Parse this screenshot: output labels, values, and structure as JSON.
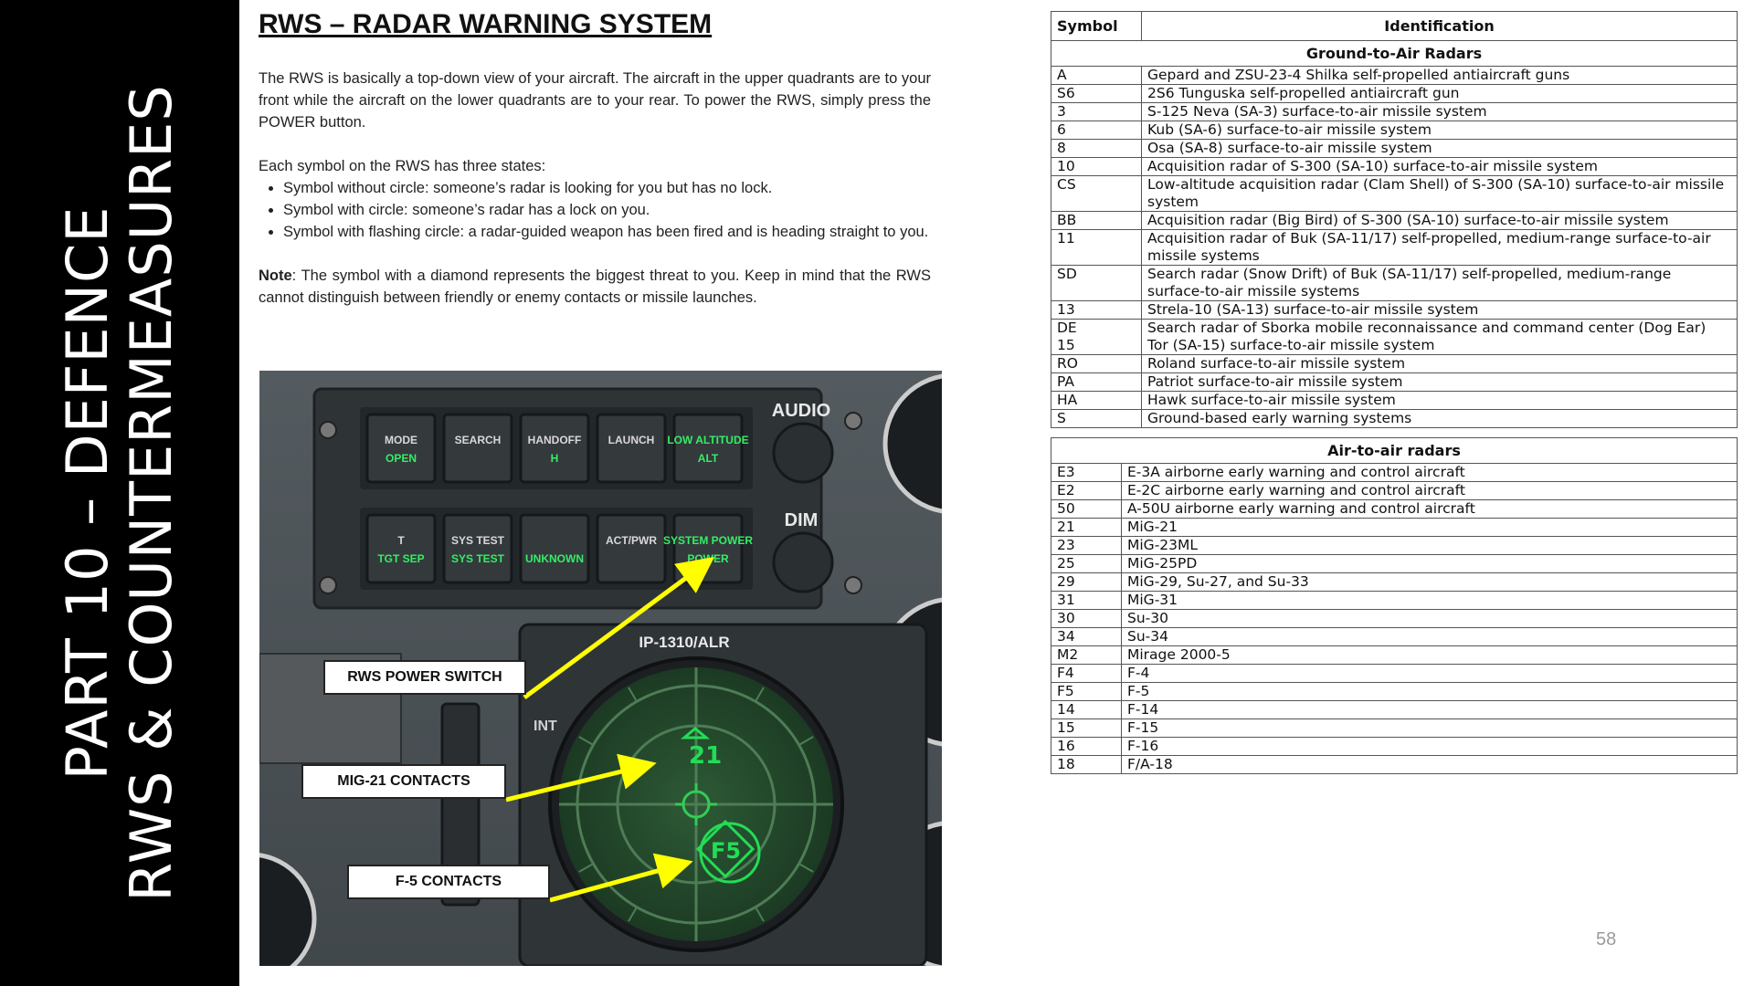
{
  "sidebar": {
    "line1": "PART 10 – DEFENCE",
    "line2": "RWS & COUNTERMEASURES"
  },
  "title": "RWS – RADAR WARNING SYSTEM",
  "intro": "The RWS is basically a top-down view of your aircraft. The aircraft in the upper quadrants are to your front while the aircraft on the lower quadrants are to your rear. To power the RWS, simply press the POWER button.",
  "states_intro": "Each symbol on the RWS has three states:",
  "states": [
    "Symbol without circle: someone’s radar is looking for you but has no lock.",
    "Symbol with circle: someone’s radar has a lock on you.",
    "Symbol with flashing circle: a radar-guided weapon has been fired and is heading straight to you."
  ],
  "note_label": "Note",
  "note_text": ": The symbol with a diamond represents the biggest threat to you. Keep in mind that the RWS cannot distinguish between friendly or enemy contacts or missile launches.",
  "figure": {
    "panel_buttons_row1": [
      {
        "top": "MODE",
        "bottom": "OPEN"
      },
      {
        "top": "SEARCH",
        "bottom": ""
      },
      {
        "top": "HANDOFF",
        "bottom": "H"
      },
      {
        "top": "LAUNCH",
        "bottom": ""
      },
      {
        "top": "LOW ALTITUDE",
        "bottom": "ALT"
      }
    ],
    "panel_buttons_row2": [
      {
        "top": "T",
        "bottom": "TGT SEP"
      },
      {
        "top": "SYS TEST",
        "bottom": "SYS TEST"
      },
      {
        "top": "",
        "bottom": "UNKNOWN"
      },
      {
        "top": "ACT/PWR",
        "bottom": ""
      },
      {
        "top": "SYSTEM POWER",
        "bottom": "POWER"
      }
    ],
    "audio_label": "AUDIO",
    "dim_label": "DIM",
    "scope_label": "IP-1310/ALR",
    "int_label": "INT",
    "contact_mig21": "21",
    "contact_f5": "F5",
    "callouts": {
      "power": "RWS POWER SWITCH",
      "mig21": "MIG-21 CONTACTS",
      "f5": "F-5 CONTACTS"
    },
    "accent": "#ffff00",
    "scope_green": "#22dd55"
  },
  "table_ground": {
    "header_symbol": "Symbol",
    "header_identification": "Identification",
    "section": "Ground-to-Air Radars",
    "rows": [
      [
        "A",
        "Gepard and ZSU-23-4 Shilka self-propelled antiaircraft guns"
      ],
      [
        "S6",
        "2S6 Tunguska self-propelled antiaircraft gun"
      ],
      [
        "3",
        "S-125 Neva (SA-3) surface-to-air missile system"
      ],
      [
        "6",
        "Kub (SA-6) surface-to-air missile system"
      ],
      [
        "8",
        "Osa (SA-8) surface-to-air missile system"
      ],
      [
        "10",
        "Acquisition radar of S-300 (SA-10) surface-to-air missile system"
      ],
      [
        "CS",
        "Low-altitude acquisition radar (Clam Shell) of S-300 (SA-10) surface-to-air missile system"
      ],
      [
        "BB",
        "Acquisition radar (Big Bird) of S-300 (SA-10) surface-to-air missile system"
      ],
      [
        "11",
        "Acquisition radar of Buk (SA-11/17) self-propelled, medium-range surface-to-air missile systems"
      ],
      [
        "SD",
        "Search radar (Snow Drift) of Buk (SA-11/17) self-propelled, medium-range surface-to-air missile systems"
      ],
      [
        "13",
        "Strela-10 (SA-13) surface-to-air missile system"
      ],
      [
        "DE\n15",
        "Search radar of Sborka mobile reconnaissance and command center (Dog Ear)\nTor (SA-15) surface-to-air missile system"
      ],
      [
        "RO",
        "Roland surface-to-air missile system"
      ],
      [
        "PA",
        "Patriot surface-to-air missile system"
      ],
      [
        "HA",
        "Hawk surface-to-air missile system"
      ],
      [
        "S",
        "Ground-based early warning systems"
      ]
    ]
  },
  "table_air": {
    "section": "Air-to-air radars",
    "rows": [
      [
        "E3",
        "E-3A airborne early warning and control aircraft"
      ],
      [
        "E2",
        "E-2C airborne early warning and control aircraft"
      ],
      [
        "50",
        "A-50U airborne early warning and control aircraft"
      ],
      [
        "21",
        "MiG-21"
      ],
      [
        "23",
        "MiG-23ML"
      ],
      [
        "25",
        "MiG-25PD"
      ],
      [
        "29",
        "MiG-29, Su-27, and Su-33"
      ],
      [
        "31",
        "MiG-31"
      ],
      [
        "30",
        "Su-30"
      ],
      [
        "34",
        "Su-34"
      ],
      [
        "M2",
        "Mirage 2000-5"
      ],
      [
        "F4",
        "F-4"
      ],
      [
        "F5",
        "F-5"
      ],
      [
        "14",
        "F-14"
      ],
      [
        "15",
        "F-15"
      ],
      [
        "16",
        "F-16"
      ],
      [
        "18",
        "F/A-18"
      ]
    ]
  },
  "page_number": "58"
}
